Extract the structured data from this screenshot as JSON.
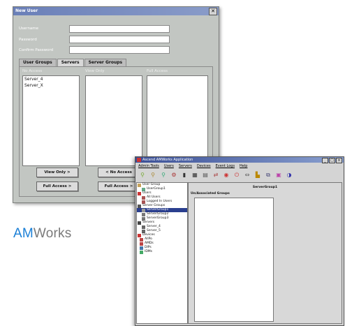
{
  "new_user_dialog": {
    "title": "New User",
    "close_glyph": "✕",
    "fields": [
      {
        "label": "Username",
        "value": ""
      },
      {
        "label": "Password",
        "value": ""
      },
      {
        "label": "Confirm Password",
        "value": ""
      }
    ],
    "tabs": [
      "User Groups",
      "Servers",
      "Server Groups"
    ],
    "active_tab": "Servers",
    "columns": {
      "no_access": {
        "header": "No Access",
        "items": [
          "Server_4",
          "Server_X"
        ]
      },
      "view_only": {
        "header": "View Only",
        "items": []
      },
      "full_access": {
        "header": "Full Access",
        "items": []
      }
    },
    "buttons": {
      "view_only": "View Only >",
      "full_access_left": "Full Access >",
      "no_access": "< No Access",
      "full_access_right": "Full Access >"
    }
  },
  "brand": {
    "am": "AM",
    "works": "Works",
    "am_color": "#1a7fd6",
    "works_color": "#7a7a7a"
  },
  "app_window": {
    "title": "Ascend AMWorks Application",
    "menu": [
      "Admin Tools",
      "Users",
      "Servers",
      "Devices",
      "Event Logs",
      "Help"
    ],
    "tree": [
      {
        "label": "User Group",
        "level": 0
      },
      {
        "label": "UserGroup1",
        "level": 1
      },
      {
        "label": "Users",
        "level": 0
      },
      {
        "label": "All Users",
        "level": 1
      },
      {
        "label": "Logged In Users",
        "level": 1
      },
      {
        "label": "Server Groups",
        "level": 0
      },
      {
        "label": "ServerGroup1",
        "level": 1
      },
      {
        "label": "ServerGroup2",
        "level": 1
      },
      {
        "label": "ServerGroup3",
        "level": 1
      },
      {
        "label": "Servers",
        "level": 0
      },
      {
        "label": "Server_4",
        "level": 1
      },
      {
        "label": "Server_5",
        "level": 1
      },
      {
        "label": "Devices",
        "level": 0
      },
      {
        "label": "AllPo",
        "level": 1
      },
      {
        "label": "AMDs",
        "level": 1
      },
      {
        "label": "DIPs",
        "level": 1
      },
      {
        "label": "IDMs",
        "level": 1
      }
    ],
    "selected_tree_item": "ServerGroup1",
    "right_header": "ServerGroup1",
    "right_subheader": "Un/Associated Groups"
  },
  "colors": {
    "dialog_bg": "#c2c6c2",
    "app_title": "#3a4f96",
    "selection": "#2a3f8f"
  }
}
